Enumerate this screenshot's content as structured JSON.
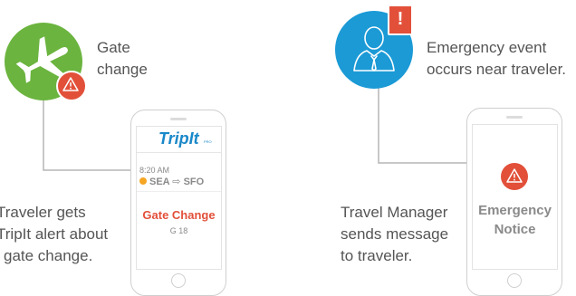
{
  "left_panel": {
    "event_label_line1": "Gate",
    "event_label_line2": "change",
    "caption_line1": "Traveler gets",
    "caption_line2": "TripIt alert about",
    "caption_line3": "gate change.",
    "phone": {
      "logo_text": "TripIt",
      "logo_suffix": "PRO",
      "time": "8:20 AM",
      "from": "SEA",
      "arrow": "⇨",
      "to": "SFO",
      "alert_title": "Gate Change",
      "gate": "G 18"
    },
    "icons": {
      "main": "airplane-icon",
      "badge": "warning-icon"
    },
    "colors": {
      "circle": "#6bb43f",
      "badge": "#e2503a",
      "alert_title": "#e2503a",
      "logo": "#1a88c9",
      "status_dot": "#f5a623"
    }
  },
  "right_panel": {
    "event_label_line1": "Emergency event",
    "event_label_line2": "occurs near traveler.",
    "caption_line1": "Travel Manager",
    "caption_line2": "sends message",
    "caption_line3": "to traveler.",
    "phone": {
      "notice_line1": "Emergency",
      "notice_line2": "Notice"
    },
    "icons": {
      "main": "person-icon",
      "badge": "exclamation-icon",
      "notice": "warning-icon"
    },
    "colors": {
      "circle": "#1b9ad6",
      "badge": "#e2503a",
      "notice_text": "#8a8a8a"
    }
  }
}
